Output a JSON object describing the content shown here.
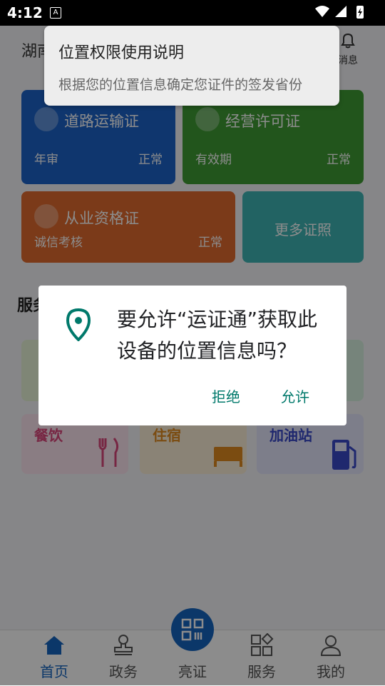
{
  "status_bar": {
    "time": "4:12",
    "notification_icon": "A"
  },
  "header": {
    "region": "湖南",
    "messages_label": "消息"
  },
  "cards": [
    {
      "title": "道路运输证",
      "sub": "年审",
      "status": "正常",
      "color": "#1d63c9"
    },
    {
      "title": "经营许可证",
      "sub": "有效期",
      "status": "正常",
      "color": "#3f9b34"
    },
    {
      "title": "从业资格证",
      "sub": "诚信考核",
      "status": "正常",
      "color": "#e06a2e"
    },
    {
      "title": "更多证照",
      "color": "#3eb5b5"
    }
  ],
  "services": {
    "title": "服务",
    "tiles": [
      {
        "label": "餐饮",
        "color": "#d9467a"
      },
      {
        "label": "住宿",
        "color": "#e08a1f"
      },
      {
        "label": "加油站",
        "color": "#3a49c9"
      }
    ]
  },
  "bottom_nav": {
    "items": [
      {
        "label": "首页",
        "active": true
      },
      {
        "label": "政务"
      },
      {
        "label": "亮证"
      },
      {
        "label": "服务"
      },
      {
        "label": "我的"
      }
    ]
  },
  "permission_tip": {
    "title": "位置权限使用说明",
    "desc": "根据您的位置信息确定您证件的签发省份"
  },
  "dialog": {
    "message": "要允许“运证通”获取此设备的位置信息吗？",
    "deny_label": "拒绝",
    "allow_label": "允许",
    "accent": "#00796b"
  }
}
